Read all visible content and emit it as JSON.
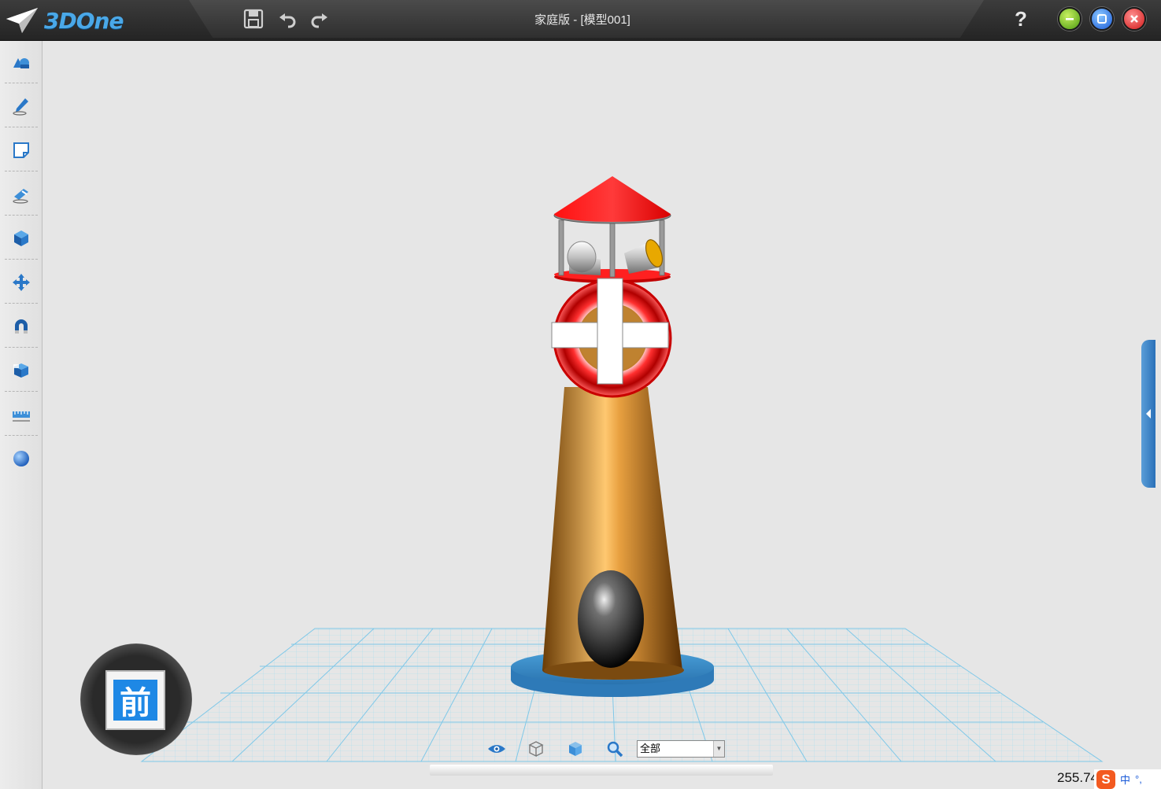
{
  "app": {
    "logo_text": "3DOne",
    "window_title": "家庭版 - [模型001]"
  },
  "titlebar": {
    "help_label": "?",
    "buttons": [
      "save-icon",
      "undo-icon",
      "redo-icon"
    ]
  },
  "left_toolbar": {
    "items": [
      "basic-solid-icon",
      "sketch-pencil-icon",
      "sketch-edit-icon",
      "special-feature-icon",
      "feature-cube-icon",
      "move-icon",
      "adsorb-magnet-icon",
      "combine-icon",
      "measure-icon",
      "render-sphere-icon"
    ]
  },
  "viewcube": {
    "face_label": "前"
  },
  "bottom_toolbar": {
    "icons": [
      "view-eye-icon",
      "wireframe-cube-icon",
      "solid-cube-icon",
      "zoom-icon"
    ],
    "filter_value": "全部"
  },
  "status": {
    "coord_value": "255.74"
  },
  "ime": {
    "logo": "S",
    "lang": "中",
    "punct": "°,"
  },
  "colors": {
    "accent": "#1e88e5",
    "grid": "#7fc8e8",
    "lighthouse_body": "#b8741a",
    "roof": "#ee1111",
    "base_disc": "#3c8ec8"
  }
}
